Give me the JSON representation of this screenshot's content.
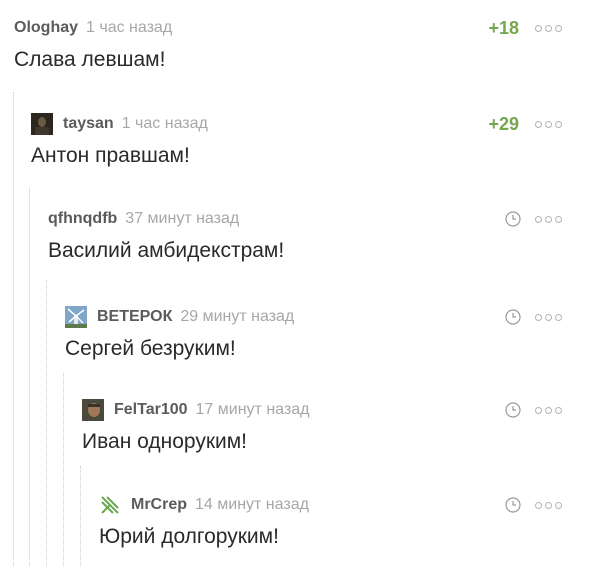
{
  "comments": [
    {
      "author": "Ologhay",
      "time": "1 час назад",
      "rating": "+18",
      "text": "Слава левшам!",
      "avatar": null
    },
    {
      "author": "taysan",
      "time": "1 час назад",
      "rating": "+29",
      "text": "Антон правшам!",
      "avatar": "dark-photo"
    },
    {
      "author": "qfhnqdfb",
      "time": "37 минут назад",
      "rating": null,
      "text": "Василий амбидекстрам!",
      "avatar": null
    },
    {
      "author": "ВЕТЕРОК",
      "time": "29 минут назад",
      "rating": null,
      "text": "Сергей безруким!",
      "avatar": "windmill"
    },
    {
      "author": "FelTar100",
      "time": "17 минут назад",
      "rating": null,
      "text": "Иван одноруким!",
      "avatar": "face-photo"
    },
    {
      "author": "MrCrep",
      "time": "14 минут назад",
      "rating": null,
      "text": "Юрий долгоруким!",
      "avatar": "green-logo"
    }
  ],
  "icons": {
    "menu": "more-dots-icon",
    "clock": "clock-icon"
  },
  "colors": {
    "rating": "#74a74e",
    "author": "#5b5b5b",
    "time": "#a7a7a7",
    "text": "#2a2a2a"
  }
}
